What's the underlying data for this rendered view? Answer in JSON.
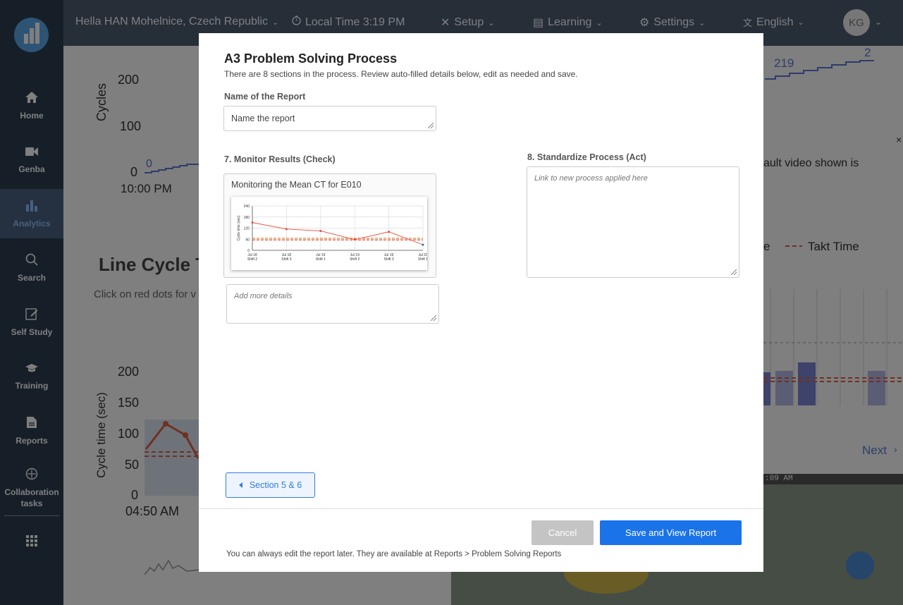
{
  "topbar": {
    "location": "Hella HAN Mohelnice, Czech Republic",
    "local_time": "Local Time 3:19 PM",
    "setup": "Setup",
    "learning": "Learning",
    "settings": "Settings",
    "language": "English",
    "avatar_initials": "KG"
  },
  "sidebar": {
    "items": [
      {
        "label": "Home",
        "icon": "home-icon"
      },
      {
        "label": "Genba",
        "icon": "video-camera-icon"
      },
      {
        "label": "Analytics",
        "icon": "bar-chart-icon"
      },
      {
        "label": "Search",
        "icon": "search-icon"
      },
      {
        "label": "Self Study",
        "icon": "edit-icon"
      },
      {
        "label": "Training",
        "icon": "graduation-cap-icon"
      },
      {
        "label": "Reports",
        "icon": "document-icon"
      },
      {
        "label": "Collaboration tasks",
        "icon": "crosshair-icon"
      }
    ],
    "apps_icon": "grid-icon"
  },
  "background": {
    "cycles_label": "Cycles",
    "cycles_ticks": [
      "200",
      "100",
      "0"
    ],
    "cycles_zero": "0",
    "time_label": "10:00 PM",
    "top_right_value": "219",
    "top_right_value2": "2",
    "video_note": "ault video shown is",
    "legend_suffix": "e",
    "takt_time": "Takt Time",
    "line_cycle_title": "Line Cycle T",
    "click_hint": "Click on red dots for v",
    "cycle_time_label": "Cycle time (sec)",
    "ct_ticks": [
      "200",
      "150",
      "100",
      "50",
      "0"
    ],
    "ct_time": "04:50 AM",
    "next": "Next",
    "video_time": ":09 AM"
  },
  "modal": {
    "title": "A3 Problem Solving Process",
    "subtitle": "There are 8 sections in the process. Review auto-filled details below, edit as needed and save.",
    "name_label": "Name of the Report",
    "name_placeholder": "Name the report",
    "section7_label": "7. Monitor Results (Check)",
    "section7_chart_title": "Monitoring the Mean CT for E010",
    "section7_details_placeholder": "Add more details",
    "section8_label": "8. Standardize Process (Act)",
    "section8_placeholder": "Link to new process applied here",
    "prev_button": "Section 5 & 6",
    "cancel_button": "Cancel",
    "save_button": "Save and View Report",
    "footnote": "You can always edit the report later. They are available at Reports > Problem Solving Reports"
  },
  "chart_data": {
    "type": "line",
    "title": "",
    "ylabel": "Cycle time (sec)",
    "ylim": [
      0,
      240
    ],
    "yticks": [
      "240",
      "180",
      "120",
      "60",
      "0"
    ],
    "categories": [
      "Jul 18 Shift 2",
      "Jul 18 Shift 3",
      "Jul 19 Shift 1",
      "Jul 19 Shift 2",
      "Jul 19 Shift 3",
      "Jul 20 Shift 1"
    ],
    "series": [
      {
        "values": [
          150,
          115,
          105,
          58,
          100,
          30
        ],
        "color": "#e74c3c"
      }
    ],
    "reference_lines": [
      {
        "value": 65,
        "color": "#e67e22",
        "style": "dashed"
      },
      {
        "value": 56,
        "color": "#e74c3c",
        "style": "dashed"
      }
    ],
    "grid": true
  }
}
